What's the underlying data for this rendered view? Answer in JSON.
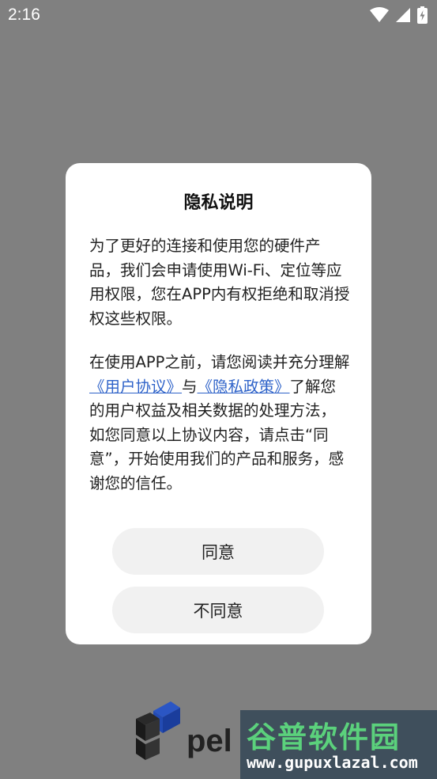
{
  "status_bar": {
    "time": "2:16",
    "icons": [
      "wifi-icon",
      "signal-icon",
      "battery-charging-icon"
    ]
  },
  "dialog": {
    "title": "隐私说明",
    "paragraph1": "为了更好的连接和使用您的硬件产品，我们会申请使用Wi-Fi、定位等应用权限，您在APP内有权拒绝和取消授权这些权限。",
    "paragraph2": {
      "before": "在使用APP之前，请您阅读并充分理解",
      "link_user_agreement": "《用户协议》",
      "middle": "与",
      "link_privacy_policy": "《隐私政策》",
      "after": "了解您的用户权益及相关数据的处理方法，如您同意以上协议内容，请点击“同意”，开始使用我们的产品和服务，感谢您的信任。"
    },
    "agree_label": "同意",
    "disagree_label": "不同意",
    "link_color": "#2f63c9"
  },
  "logo": {
    "text": "pel",
    "brand_color": "#1f47a8"
  },
  "watermark": {
    "text_cn": "谷普软件园",
    "url": "www.gupuxlazal.com"
  }
}
